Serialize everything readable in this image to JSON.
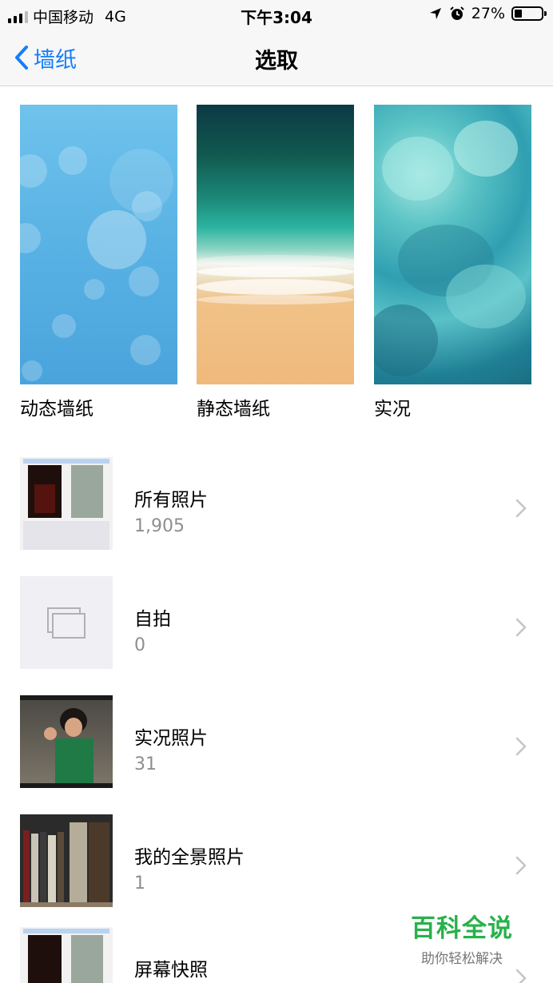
{
  "status_bar": {
    "carrier": "中国移动",
    "network": "4G",
    "time": "下午3:04",
    "battery": "27%",
    "battery_level": 0.27
  },
  "nav": {
    "back_label": "墙纸",
    "title": "选取"
  },
  "wallpapers": [
    {
      "label": "动态墙纸"
    },
    {
      "label": "静态墙纸"
    },
    {
      "label": "实况"
    }
  ],
  "albums": [
    {
      "title": "所有照片",
      "count": "1,905"
    },
    {
      "title": "自拍",
      "count": "0"
    },
    {
      "title": "实况照片",
      "count": "31"
    },
    {
      "title": "我的全景照片",
      "count": "1"
    },
    {
      "title": "屏幕快照",
      "count": ""
    }
  ],
  "watermark": {
    "title": "百科全说",
    "subtitle": "助你轻松解决"
  },
  "colors": {
    "accent": "#157efb",
    "secondary_text": "#8e8e93",
    "watermark_green": "#27b24a"
  }
}
